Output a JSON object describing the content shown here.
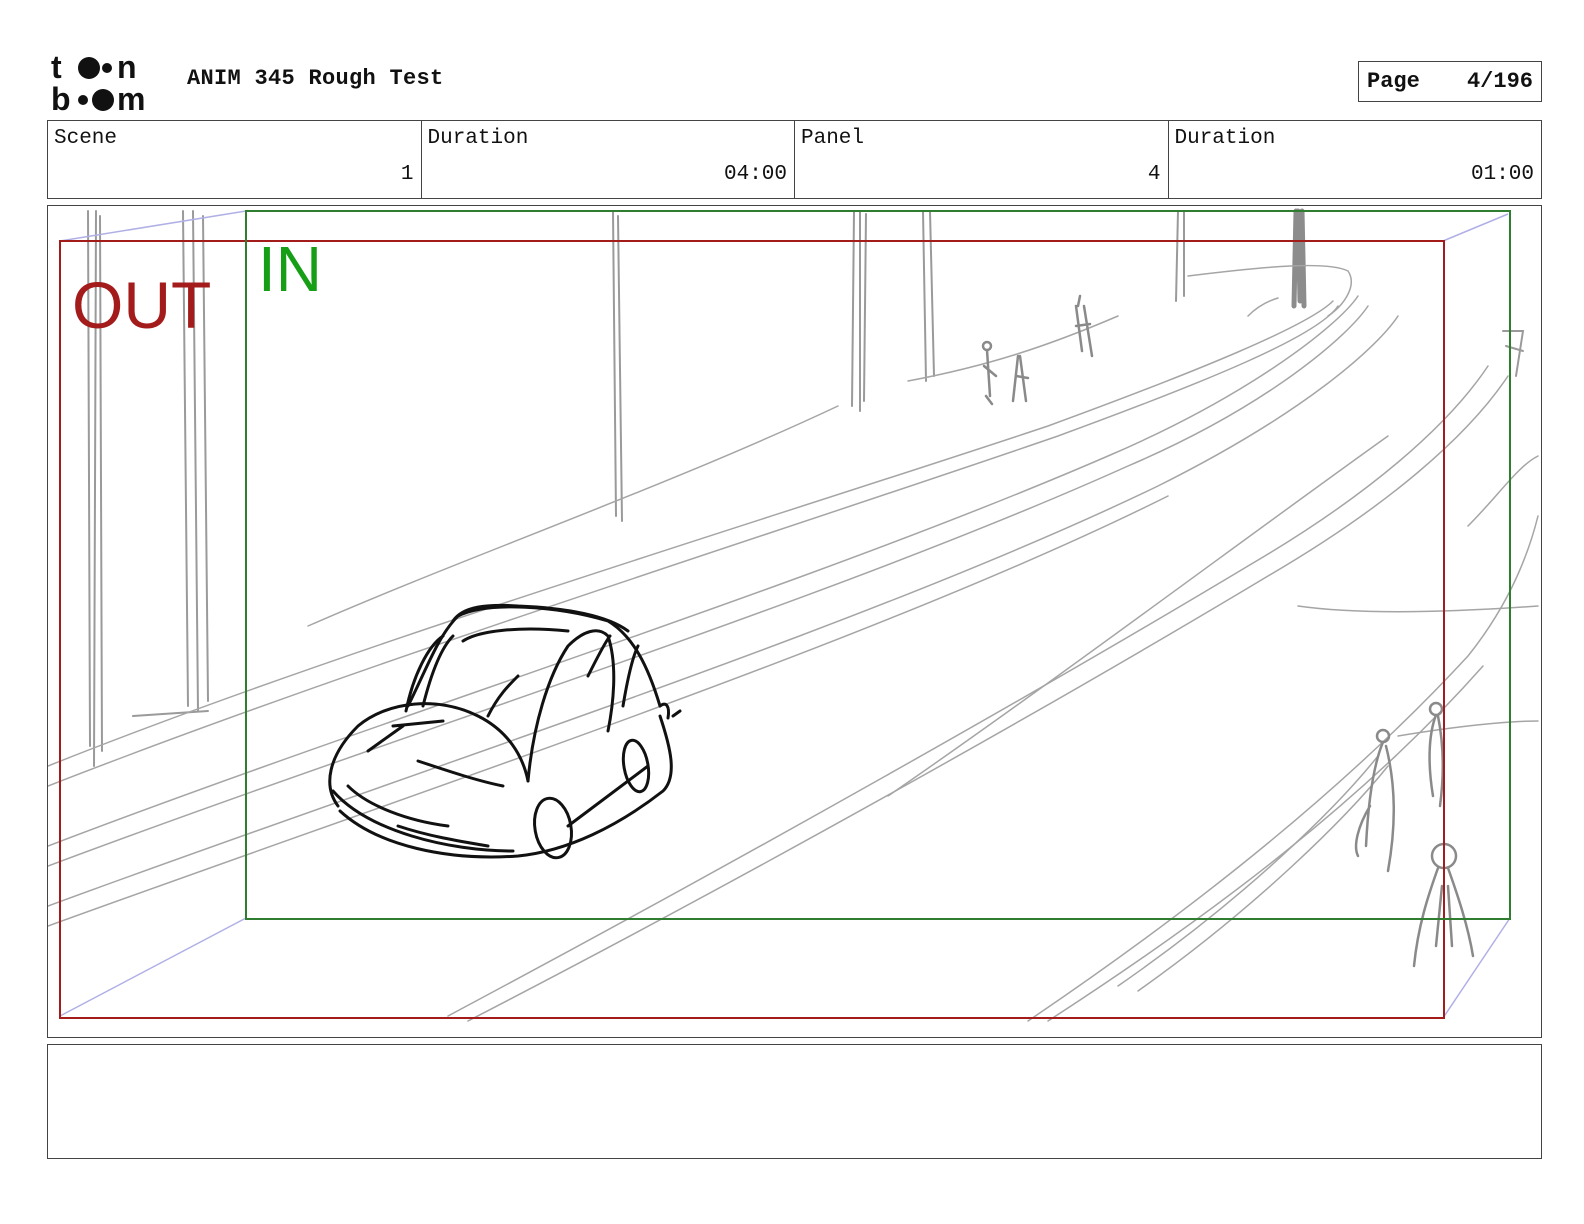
{
  "header": {
    "logo_top": "t●●n",
    "logo_bottom": "b●●m",
    "title": "ANIM 345 Rough Test",
    "page_label": "Page",
    "page_value": "4/196"
  },
  "info": {
    "scene_label": "Scene",
    "scene_value": "1",
    "scene_duration_label": "Duration",
    "scene_duration_value": "04:00",
    "panel_label": "Panel",
    "panel_value": "4",
    "panel_duration_label": "Duration",
    "panel_duration_value": "01:00"
  },
  "frame": {
    "out_label": "OUT",
    "in_label": "IN",
    "out_color": "#a31b1b",
    "in_color": "#169e16"
  },
  "notes": {
    "text": ""
  }
}
